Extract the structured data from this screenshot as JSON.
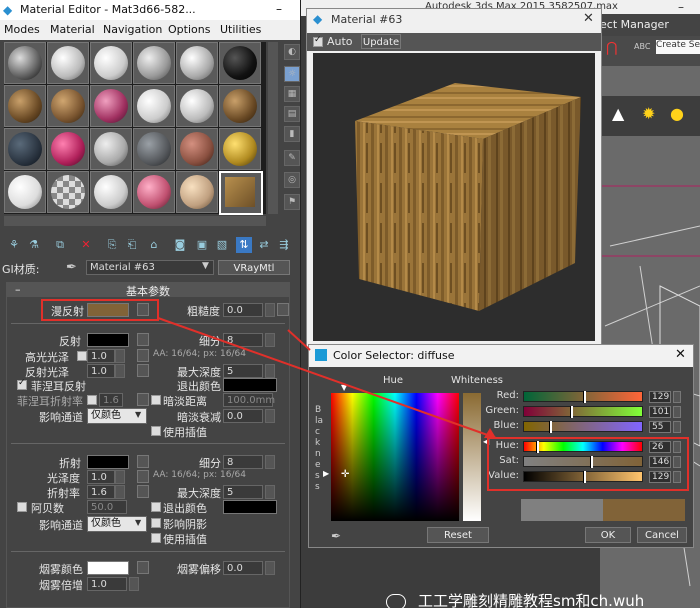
{
  "colors": {
    "accent_red": "#e0302a",
    "swatch": "#816338",
    "dialog_icon": "#1b9ad6"
  },
  "background_app": {
    "title": "Autodesk 3ds Max 2015    3582507.max",
    "menu": "ect Manager",
    "search": "Create Selection Se"
  },
  "material_editor": {
    "title": "Material Editor - Mat3d66-582...",
    "menu": [
      "Modes",
      "Material",
      "Navigation",
      "Options",
      "Utilities"
    ],
    "gi_label": "GI材质:",
    "material_name": "Material #63",
    "material_type": "VRayMtl",
    "rollout_title": "基本参数",
    "diffuse": {
      "label": "漫反射",
      "roughness_label": "粗糙度",
      "roughness": "0.0"
    },
    "reflect": {
      "label": "反射",
      "subdivs_label": "细分",
      "subdivs": "8",
      "hilight_label": "高光光泽",
      "hilight": "1.0",
      "aa_text": "AA: 16/64; px: 16/64",
      "gloss_label": "反射光泽",
      "gloss": "1.0",
      "max_depth_label": "最大深度",
      "max_depth": "5",
      "fresnel_label": "菲涅耳反射",
      "exit_color_label": "退出颜色",
      "fresnel_ior_label": "菲涅耳折射率",
      "fresnel_ior": "1.6",
      "dim_distance_label": "暗淡距离",
      "dim_distance": "100.0mm",
      "affect_channel_label": "影响通道",
      "affect_channel": "仅颜色",
      "dim_falloff_label": "暗淡衰减",
      "dim_falloff": "0.0",
      "use_interp_label": "使用插值"
    },
    "refract": {
      "label": "折射",
      "subdivs_label": "细分",
      "subdivs": "8",
      "gloss_label": "光泽度",
      "gloss": "1.0",
      "aa_text": "AA: 16/64; px: 16/64",
      "ior_label": "折射率",
      "ior": "1.6",
      "max_depth_label": "最大深度",
      "max_depth": "5",
      "abbe_label": "阿贝数",
      "abbe": "50.0",
      "exit_color_label": "退出颜色",
      "affect_channel_label": "影响通道",
      "affect_channel": "仅颜色",
      "affect_shadows_label": "影响阴影",
      "use_interp_label": "使用插值"
    },
    "fog": {
      "color_label": "烟雾颜色",
      "bias_label": "烟雾偏移",
      "bias": "0.0",
      "multiplier_label": "烟雾倍增",
      "multiplier": "1.0"
    }
  },
  "preview": {
    "title": "Material #63",
    "auto_label": "Auto",
    "update_label": "Update"
  },
  "color_selector": {
    "title": "Color Selector: diffuse",
    "hue_header": "Hue",
    "whiteness_header": "Whiteness",
    "blackness_label": "Blackness",
    "channels": [
      {
        "label": "Red:",
        "value": "129",
        "fraction": 0.506
      },
      {
        "label": "Green:",
        "value": "101",
        "fraction": 0.396
      },
      {
        "label": "Blue:",
        "value": "55",
        "fraction": 0.216
      },
      {
        "label": "Hue:",
        "value": "26",
        "fraction": 0.102
      },
      {
        "label": "Sat:",
        "value": "146",
        "fraction": 0.573
      },
      {
        "label": "Value:",
        "value": "129",
        "fraction": 0.506
      }
    ],
    "reset_label": "Reset",
    "ok_label": "OK",
    "cancel_label": "Cancel"
  },
  "watermark": "工工学雕刻精雕教程sm和ch.wuh"
}
